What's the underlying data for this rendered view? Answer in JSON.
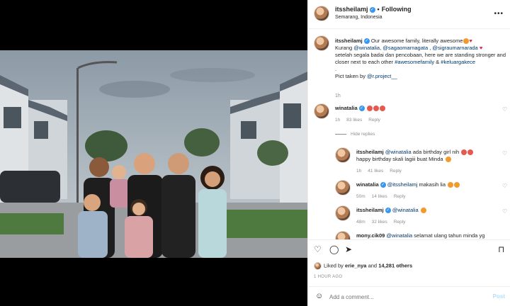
{
  "header": {
    "username": "itssheilamj",
    "following": "Following",
    "location": "Semarang, Indonesia"
  },
  "caption": {
    "username": "itssheilamj",
    "line1": "Our awesome family, literally awesome",
    "kurang": "Kurang",
    "m1": "@winatalia",
    "m2": "@sagaomarnagata",
    "m3": "@sigraumarnarada",
    "line3": "setelah segala badai dan pencobaan, here we are standing stronger and closer next to each other",
    "tag1": "#awesomefamily",
    "amp": "&",
    "tag2": "#keluargakece",
    "dot": ".",
    "credit": "Pict taken by",
    "credit_mention": "@r.project__",
    "time": "1h"
  },
  "comments": [
    {
      "username": "winatalia",
      "text": "",
      "time": "1h",
      "likes": "83 likes",
      "reply": "Reply"
    },
    {
      "username": "itssheilamj",
      "mention": "@winatalia",
      "text": "ada birthday girl nih",
      "text2": "happy birthday skali lagiii buat Minda",
      "time": "1h",
      "likes": "41 likes",
      "reply": "Reply"
    },
    {
      "username": "winatalia",
      "mention": "@itssheilamj",
      "text": "makasih lia",
      "time": "50m",
      "likes": "14 likes",
      "reply": "Reply"
    },
    {
      "username": "itssheilamj",
      "mention": "@winatalia",
      "text": "",
      "time": "48m",
      "likes": "32 likes",
      "reply": "Reply"
    },
    {
      "username": "mony.cik09",
      "mention": "@winatalia",
      "text": "selamat ulang tahun minda yg"
    }
  ],
  "hide_replies": "Hide replies",
  "likes": {
    "prefix": "Liked by",
    "user": "erie_nya",
    "and": "and",
    "count": "14,281 others"
  },
  "posted": "1 HOUR AGO",
  "add_comment": {
    "placeholder": "Add a comment...",
    "post": "Post"
  },
  "icons": [
    "more-icon",
    "heart-icon",
    "comment-icon",
    "share-icon",
    "bookmark-icon",
    "smile-icon",
    "verified-icon"
  ]
}
